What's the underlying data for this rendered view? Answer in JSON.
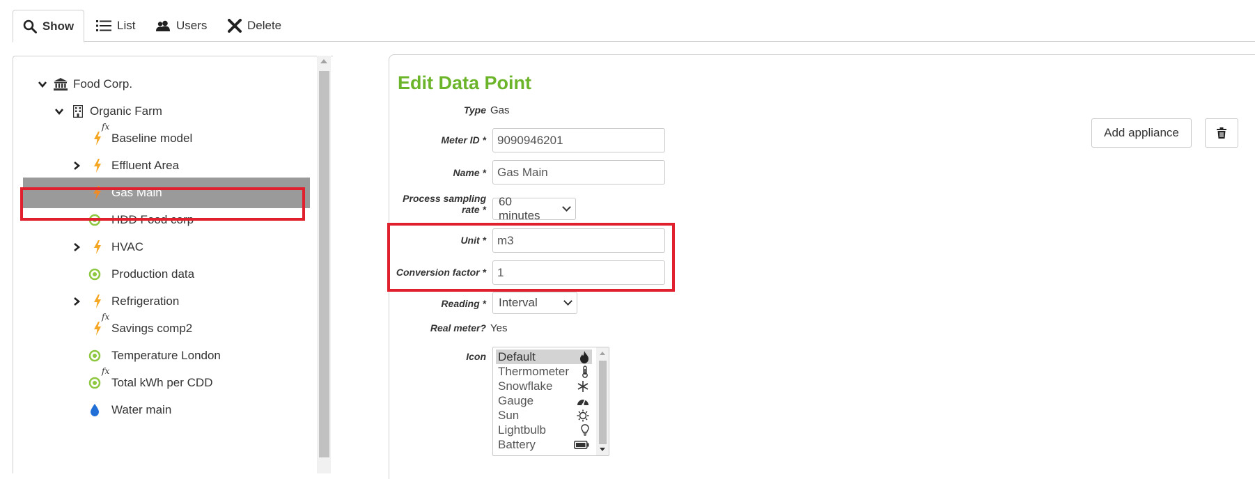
{
  "tabs": {
    "show": "Show",
    "list": "List",
    "users": "Users",
    "delete": "Delete"
  },
  "tree": {
    "items": [
      {
        "label": "Food Corp.",
        "icon": "bank-icon"
      },
      {
        "label": "Organic Farm",
        "icon": "building-icon"
      },
      {
        "label": "Baseline model",
        "icon": "bolt-fx-icon"
      },
      {
        "label": "Effluent Area",
        "icon": "bolt-icon"
      },
      {
        "label": "Gas Main",
        "icon": "flame-icon"
      },
      {
        "label": "HDD Food corp",
        "icon": "target-icon"
      },
      {
        "label": "HVAC",
        "icon": "bolt-icon"
      },
      {
        "label": "Production data",
        "icon": "target-icon"
      },
      {
        "label": "Refrigeration",
        "icon": "bolt-icon"
      },
      {
        "label": "Savings comp2",
        "icon": "bolt-fx-icon"
      },
      {
        "label": "Temperature London",
        "icon": "target-icon"
      },
      {
        "label": "Total kWh per CDD",
        "icon": "target-fx-icon"
      },
      {
        "label": "Water main",
        "icon": "droplet-icon"
      }
    ],
    "fx_label": "fx"
  },
  "form": {
    "title": "Edit Data Point",
    "type_label": "Type",
    "type_value": "Gas",
    "meter_id_label": "Meter ID *",
    "meter_id_value": "9090946201",
    "name_label": "Name *",
    "name_value": "Gas Main",
    "sampling_label_line1": "Process sampling",
    "sampling_label_line2": "rate *",
    "sampling_value": "60 minutes",
    "unit_label": "Unit *",
    "unit_value": "m3",
    "conversion_label": "Conversion factor *",
    "conversion_value": "1",
    "reading_label": "Reading *",
    "reading_value": "Interval",
    "real_meter_label": "Real meter?",
    "real_meter_value": "Yes",
    "icon_label": "Icon",
    "icon_options": [
      {
        "label": "Default",
        "icon": "flame-icon"
      },
      {
        "label": "Thermometer",
        "icon": "thermometer-icon"
      },
      {
        "label": "Snowflake",
        "icon": "snowflake-icon"
      },
      {
        "label": "Gauge",
        "icon": "gauge-icon"
      },
      {
        "label": "Sun",
        "icon": "sun-icon"
      },
      {
        "label": "Lightbulb",
        "icon": "lightbulb-icon"
      },
      {
        "label": "Battery",
        "icon": "battery-icon"
      }
    ]
  },
  "actions": {
    "add_appliance": "Add appliance"
  },
  "colors": {
    "title_green": "#6cb52b",
    "bolt_orange": "#f5a623",
    "target_green": "#8dc63f",
    "water_blue": "#1f6fd6",
    "highlight_red": "#e0202d",
    "selected_gray": "#9a9a9a"
  }
}
